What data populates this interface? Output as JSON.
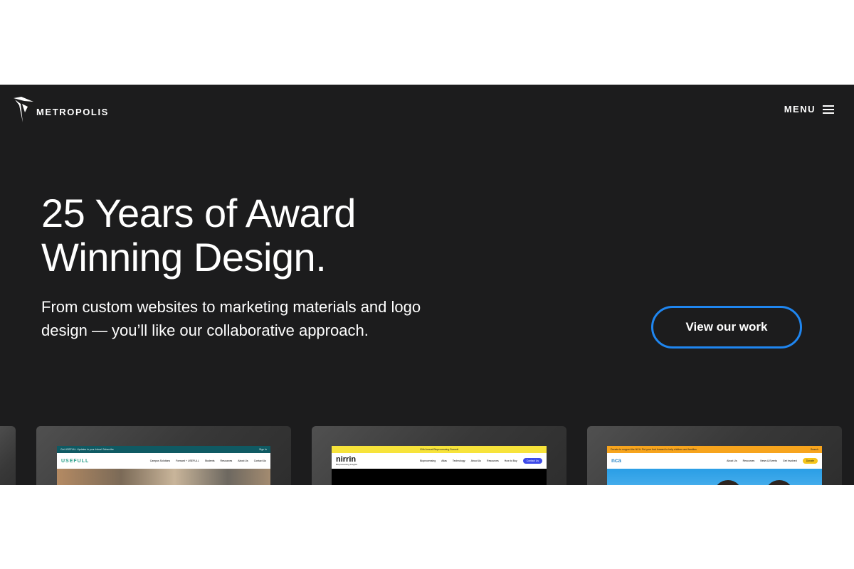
{
  "brand": {
    "name": "METROPOLIS",
    "logo_icon": "metropolis-mark-icon"
  },
  "nav": {
    "menu_label": "MENU",
    "menu_icon": "hamburger-icon"
  },
  "hero": {
    "headline_line1": "25 Years of Award",
    "headline_line2": "Winning Design.",
    "subtext_line1": "From custom websites to marketing materials and logo",
    "subtext_line2": "design — you’ll like our collaborative approach.",
    "cta_label": "View our work"
  },
  "colors": {
    "background": "#1c1c1d",
    "accent": "#1f86f0",
    "text": "#ffffff"
  },
  "portfolio": {
    "cards": [
      {
        "id": "usefull",
        "topbar_text": "Get USEFULL Updates in your Inbox! Subscribe",
        "topbar_right": "Sign In",
        "logo": "USEFULL",
        "nav": [
          "Campus Solutions",
          "Forward + USEFULL",
          "Students",
          "Resources",
          "About Us",
          "Contact Us"
        ]
      },
      {
        "id": "nirrin",
        "topbar_text": "10th Annual Bioprocessing Summit",
        "logo": "nirrin",
        "logo_tagline": "Bioprocessing Insights",
        "nav": [
          "Bioprocessing",
          "Atlas",
          "Technology",
          "About Us",
          "Resources",
          "How to Buy"
        ],
        "button": "Contact Us"
      },
      {
        "id": "nca",
        "topbar_text": "Donate to support the NCA. Put your foot forward to help children and families",
        "topbar_right": "Search",
        "logo": "nca",
        "nav": [
          "About Us",
          "Resources",
          "News & Events",
          "Get Involved"
        ],
        "button": "Donate"
      }
    ]
  }
}
